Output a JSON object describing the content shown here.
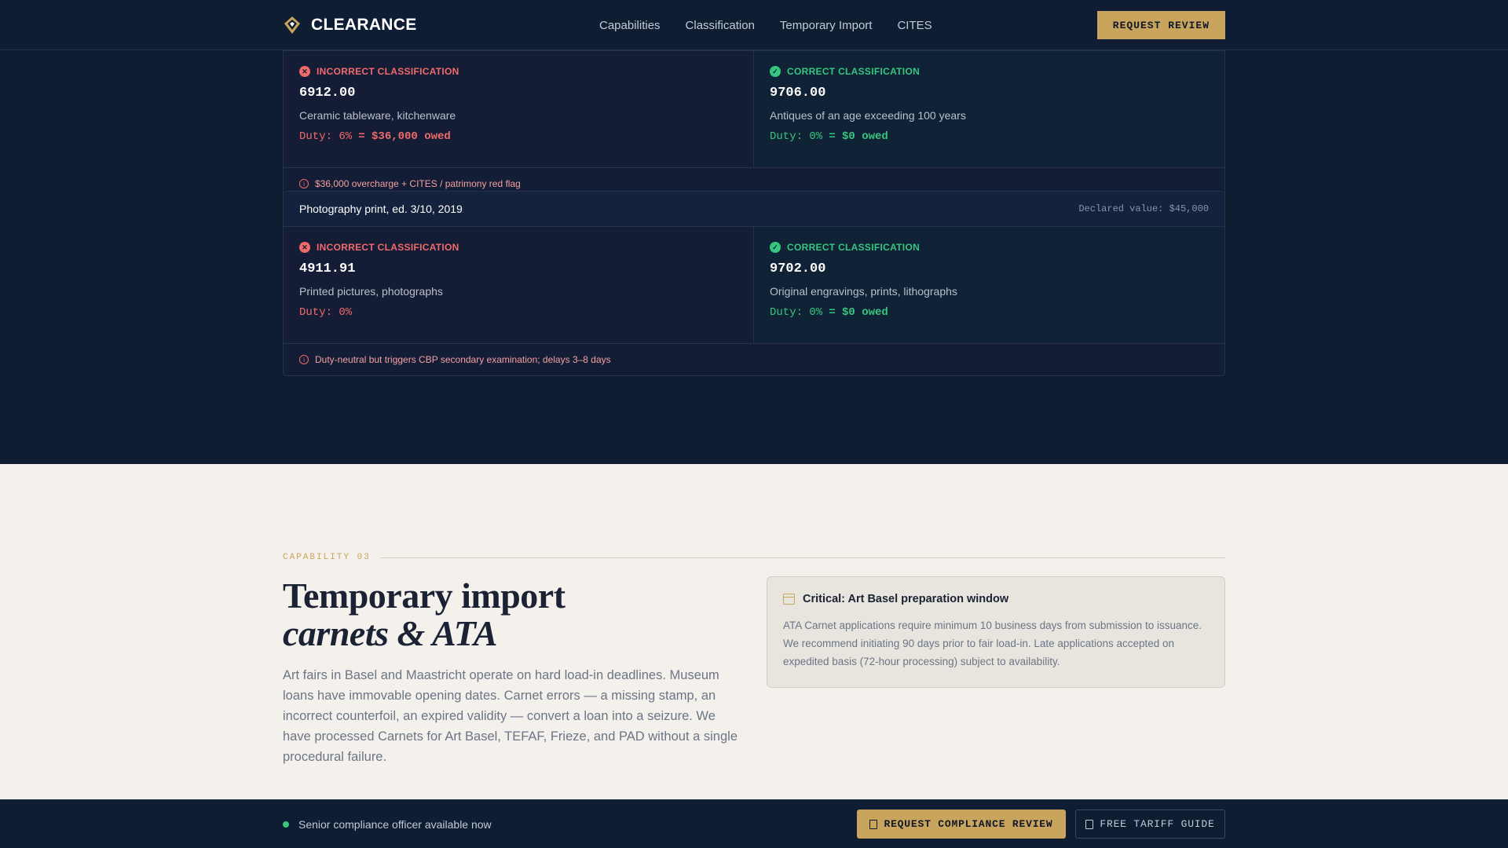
{
  "nav": {
    "brand": "CLEARANCE",
    "links": [
      "Capabilities",
      "Classification",
      "Temporary Import",
      "CITES"
    ],
    "cta": "REQUEST REVIEW"
  },
  "cards": [
    {
      "wrong": {
        "label": "INCORRECT CLASSIFICATION",
        "code": "6912.00",
        "desc": "Ceramic tableware, kitchenware",
        "duty": "Duty: 6%",
        "owed": "= $36,000 owed"
      },
      "right": {
        "label": "CORRECT CLASSIFICATION",
        "code": "9706.00",
        "desc": "Antiques of an age exceeding 100 years",
        "duty": "Duty: 0%",
        "owed": "= $0 owed"
      },
      "note": "$36,000 overcharge + CITES / patrimony red flag"
    },
    {
      "title": "Photography print, ed. 3/10, 2019",
      "declared": "Declared value: $45,000",
      "wrong": {
        "label": "INCORRECT CLASSIFICATION",
        "code": "4911.91",
        "desc": "Printed pictures, photographs",
        "duty": "Duty: 0%",
        "owed": ""
      },
      "right": {
        "label": "CORRECT CLASSIFICATION",
        "code": "9702.00",
        "desc": "Original engravings, prints, lithographs",
        "duty": "Duty: 0%",
        "owed": "= $0 owed"
      },
      "note": "Duty-neutral but triggers CBP secondary examination; delays 3–8 days"
    }
  ],
  "capability": {
    "label": "CAPABILITY 03",
    "heading_line1": "Temporary import",
    "heading_line2": "carnets & ATA",
    "body": "Art fairs in Basel and Maastricht operate on hard load-in deadlines. Museum loans have immovable opening dates. Carnet errors — a missing stamp, an incorrect counterfoil, an expired validity — convert a loan into a seizure. We have processed Carnets for Art Basel, TEFAF, Frieze, and PAD without a single procedural failure.",
    "callout_title": "Critical: Art Basel preparation window",
    "callout_text": "ATA Carnet applications require minimum 10 business days from submission to issuance. We recommend initiating 90 days prior to fair load-in. Late applications accepted on expedited basis (72-hour processing) subject to availability."
  },
  "bar": {
    "status": "Senior compliance officer available now",
    "primary": "REQUEST COMPLIANCE REVIEW",
    "secondary": "FREE TARIFF GUIDE"
  },
  "colors": {
    "navy": "#0f1d33",
    "gold": "#c9a45c",
    "red": "#f06a6a",
    "green": "#36c77e",
    "cream": "#f4f1ec"
  }
}
